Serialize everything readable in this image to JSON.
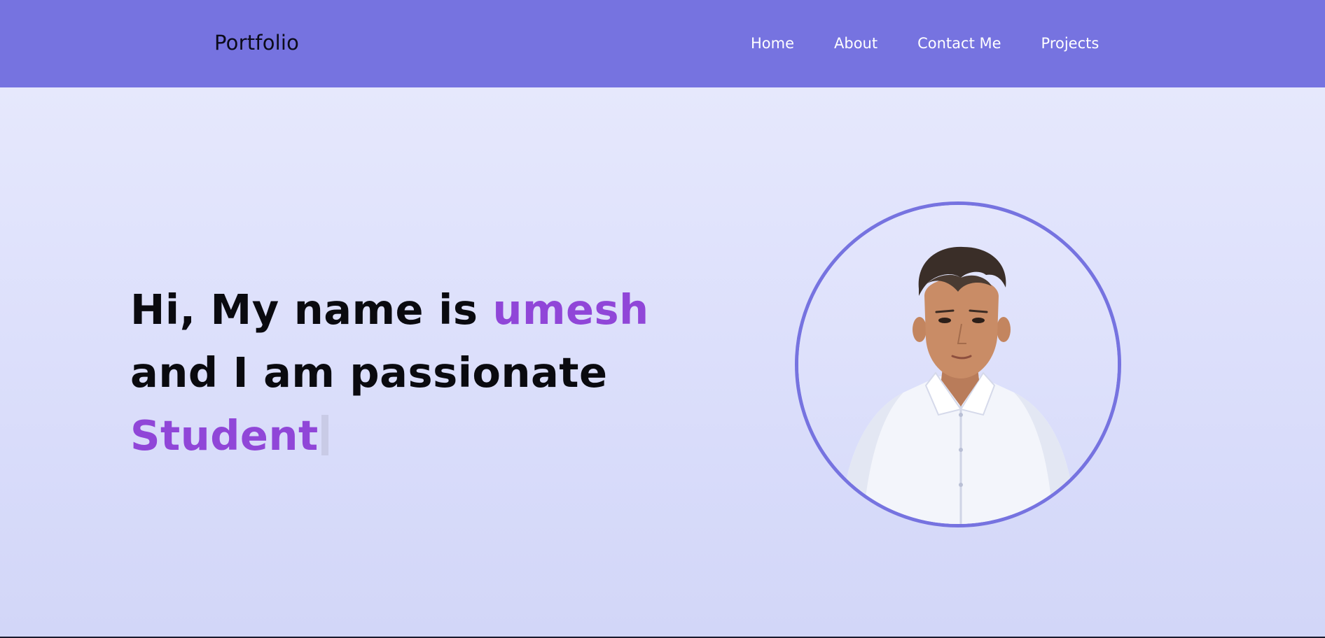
{
  "header": {
    "brand": "Portfolio",
    "nav": [
      "Home",
      "About",
      "Contact Me",
      "Projects"
    ]
  },
  "hero": {
    "line1_prefix": "Hi, My name is",
    "name": "umesh",
    "line2": "and I am passionate",
    "typed_role": "Student"
  },
  "colors": {
    "nav_bg": "#7673e0",
    "accent": "#9046d8",
    "text": "#0a0a0f"
  },
  "image": {
    "subject": "profile-photo"
  }
}
